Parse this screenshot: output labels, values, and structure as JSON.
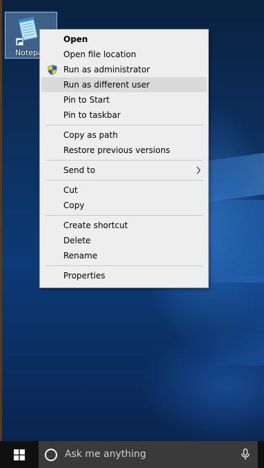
{
  "desktop": {
    "icon": {
      "label": "Notepa",
      "icon_name": "notepad-shortcut-icon"
    }
  },
  "context_menu": {
    "items": [
      {
        "label": "Open",
        "bold": true
      },
      {
        "label": "Open file location"
      },
      {
        "label": "Run as administrator",
        "icon": "uac-shield-icon"
      },
      {
        "label": "Run as different user",
        "highlighted": true
      },
      {
        "label": "Pin to Start"
      },
      {
        "label": "Pin to taskbar"
      },
      {
        "label": "Copy as path"
      },
      {
        "label": "Restore previous versions"
      },
      {
        "label": "Send to",
        "submenu": true
      },
      {
        "label": "Cut"
      },
      {
        "label": "Copy"
      },
      {
        "label": "Create shortcut"
      },
      {
        "label": "Delete"
      },
      {
        "label": "Rename"
      },
      {
        "label": "Properties"
      }
    ]
  },
  "taskbar": {
    "search_placeholder": "Ask me anything",
    "start_icon": "windows-logo-icon",
    "cortana_icon": "cortana-circle-icon",
    "mic_icon": "microphone-icon"
  },
  "colors": {
    "menu_bg": "#eeeeee",
    "menu_highlight": "#dadada",
    "taskbar_bg": "#101010",
    "search_bg": "#3a3a3a",
    "desktop_blue": "#0c3a76"
  }
}
